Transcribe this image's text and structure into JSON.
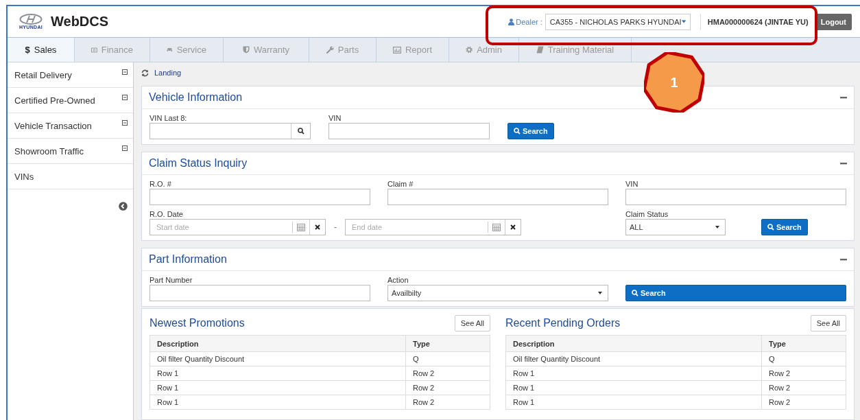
{
  "header": {
    "logo_text": "HYUNDAI",
    "app_title": "WebDCS",
    "dealer_label": "Dealer :",
    "dealer_value": "CA355 - NICHOLAS PARKS HYUNDAI",
    "user": "HMA000000624 (JINTAE YU)",
    "logout": "Logout"
  },
  "tabs": [
    {
      "glyph": "$",
      "label": "Sales",
      "selected": true
    },
    {
      "label": "Finance",
      "selected": false
    },
    {
      "label": "Service",
      "selected": false
    },
    {
      "label": "Warranty",
      "selected": false
    },
    {
      "label": "Parts",
      "selected": false
    },
    {
      "label": "Report",
      "selected": false
    },
    {
      "label": "Admin",
      "selected": false
    },
    {
      "label": "Training Material",
      "selected": false
    }
  ],
  "sidebar": {
    "items": [
      {
        "label": "Retail Delivery",
        "kind": "group"
      },
      {
        "label": "Certified Pre-Owned",
        "kind": "group"
      },
      {
        "label": "Vehicle Transaction",
        "kind": "group"
      },
      {
        "label": "Showroom Traffic",
        "kind": "group"
      },
      {
        "label": "VINs",
        "kind": "link"
      }
    ]
  },
  "breadcrumb": "Landing",
  "vehicle_information": {
    "title": "Vehicle Information",
    "vin_last8_label": "VIN Last 8:",
    "vin_label": "VIN",
    "button": "Search"
  },
  "claim_status_inquiry": {
    "title": "Claim Status Inquiry",
    "fields": [
      {
        "label": "R.O. #"
      },
      {
        "label": "Claim #"
      },
      {
        "label": "VIN"
      }
    ],
    "date_label": "R.O. Date",
    "start_placeholder": "Start date",
    "separator": "-",
    "end_placeholder": "End date",
    "status_label": "Claim Status",
    "status_value": "ALL",
    "button": "Search"
  },
  "part_information": {
    "title": "Part Information",
    "part_number_label": "Part Number",
    "action_label": "Action",
    "action_value": "Availbilty",
    "button": "Search"
  },
  "lists": [
    {
      "title": "Newest Promotions",
      "see_all": "See All",
      "columns": [
        "Description",
        "Type"
      ],
      "rows": [
        [
          "Oil filter Quantity Discount",
          "Q"
        ],
        [
          "Row 1",
          "Row 2"
        ],
        [
          "Row 1",
          "Row 2"
        ],
        [
          "Row 1",
          "Row 2"
        ]
      ]
    },
    {
      "title": "Recent Pending Orders",
      "see_all": "See All",
      "columns": [
        "Description",
        "Type"
      ],
      "rows": [
        [
          "Oil filter Quantity Discount",
          "Q"
        ],
        [
          "Row 1",
          "Row 2"
        ],
        [
          "Row 1",
          "Row 2"
        ],
        [
          "Row 1",
          "Row 2"
        ]
      ]
    }
  ],
  "callout": {
    "label": "1"
  }
}
